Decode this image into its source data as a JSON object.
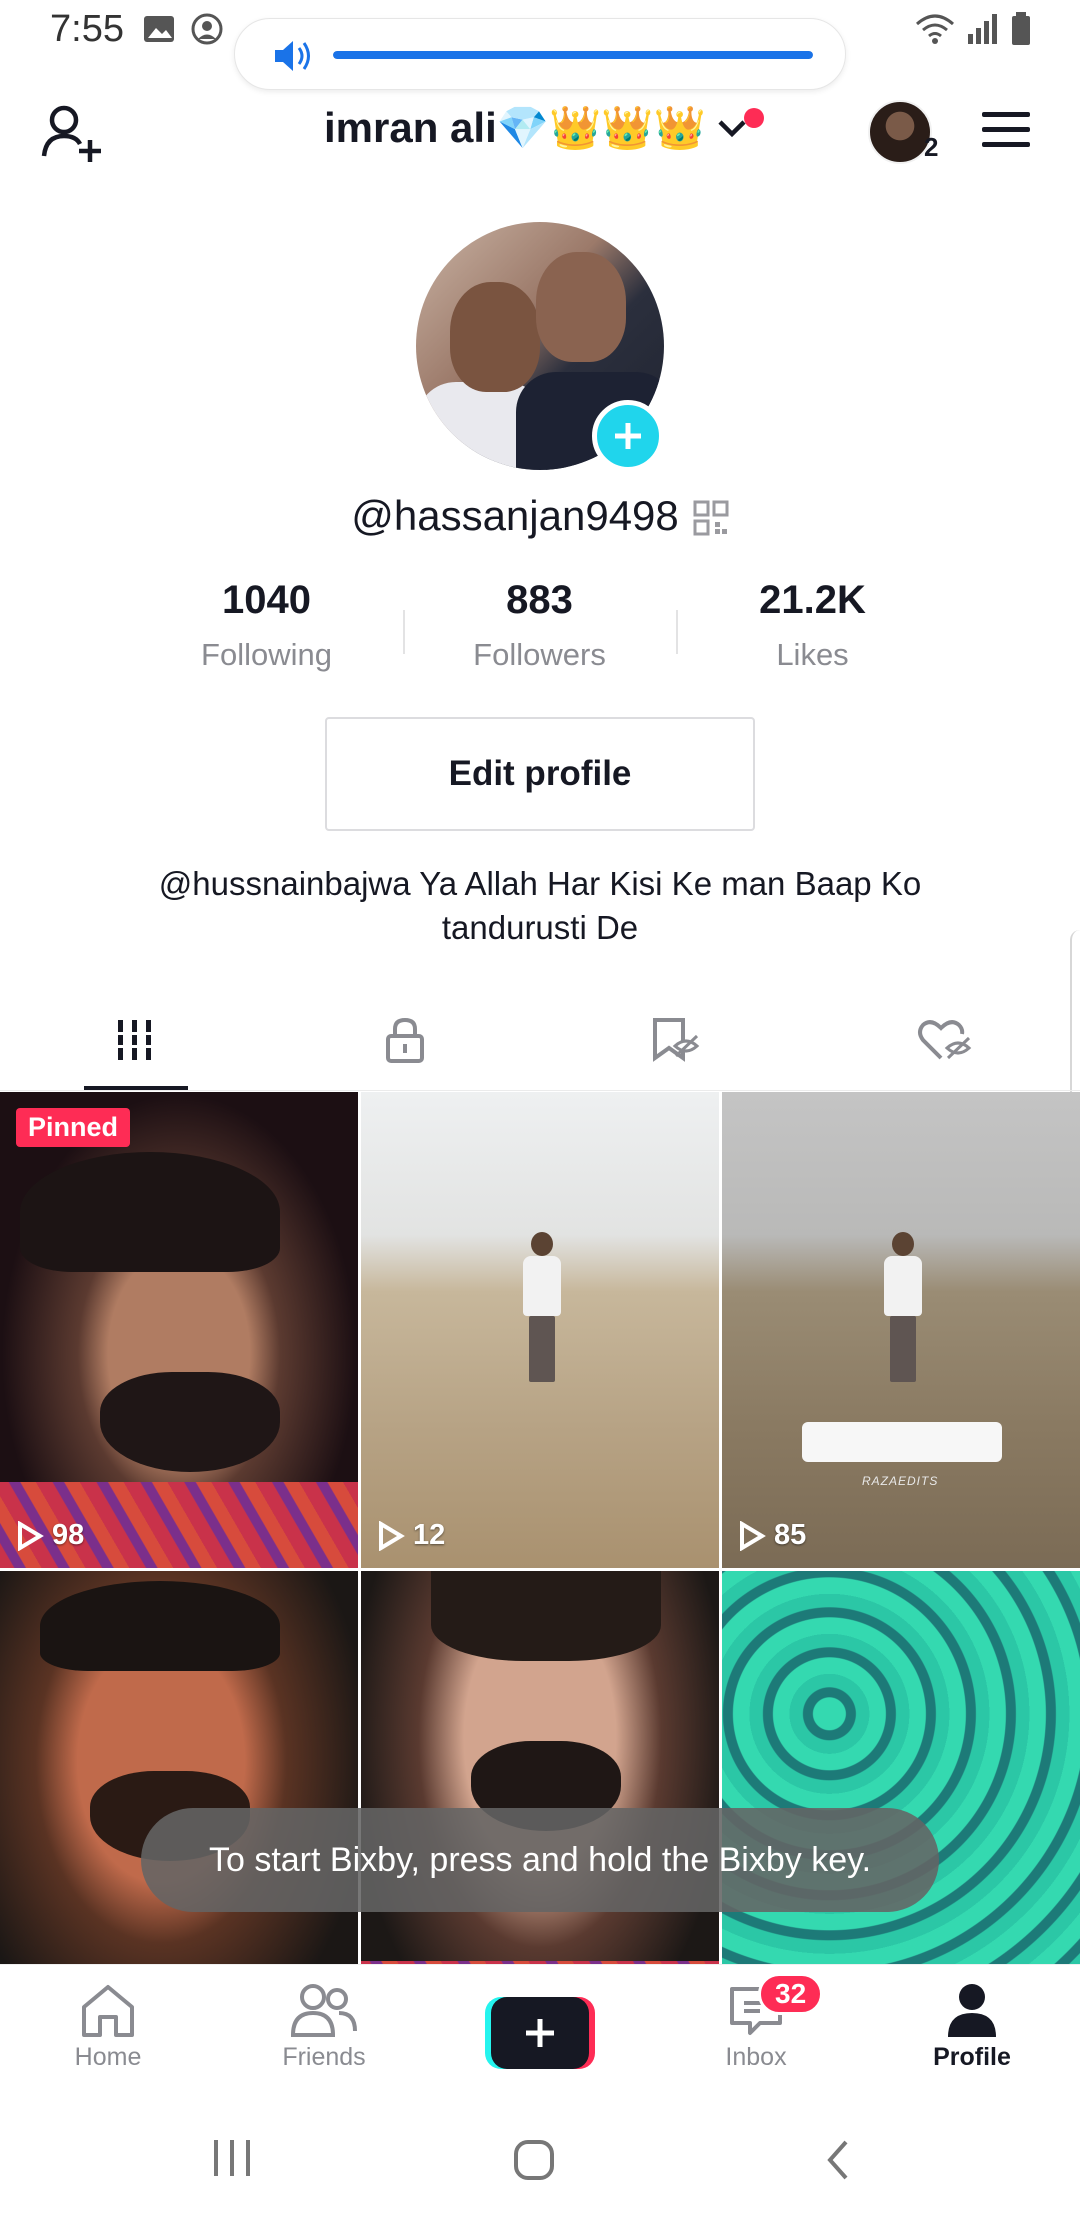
{
  "status_bar": {
    "time": "7:55"
  },
  "volume": {
    "level_percent": 100,
    "color": "#1a73e8"
  },
  "header": {
    "username": "imran ali💎👑👑👑",
    "following_avatar_count": "2"
  },
  "profile": {
    "handle": "@hassanjan9498",
    "stats": [
      {
        "value": "1040",
        "label": "Following"
      },
      {
        "value": "883",
        "label": "Followers"
      },
      {
        "value": "21.2K",
        "label": "Likes"
      }
    ],
    "edit_profile_label": "Edit profile",
    "bio_line1": "@hussnainbajwa Ya Allah Har Kisi Ke man Baap Ko",
    "bio_line2": "tandurusti De"
  },
  "tabs": [
    {
      "icon": "grid-icon",
      "active": true
    },
    {
      "icon": "lock-icon",
      "active": false
    },
    {
      "icon": "favorites-hidden-icon",
      "active": false
    },
    {
      "icon": "liked-hidden-icon",
      "active": false
    }
  ],
  "videos": [
    {
      "views": "98",
      "pinned_label": "Pinned"
    },
    {
      "views": "12"
    },
    {
      "views": "85",
      "watermark": "RAZAEDITS"
    },
    {
      "views": ""
    },
    {
      "views": ""
    },
    {
      "views": ""
    }
  ],
  "toast": "To start Bixby, press and hold the Bixby key.",
  "bottom_nav": {
    "home": "Home",
    "friends": "Friends",
    "inbox": "Inbox",
    "inbox_badge": "32",
    "profile": "Profile"
  },
  "colors": {
    "accent": "#fe2c55",
    "cyan": "#20d5ec",
    "text": "#161823",
    "muted": "#8a8b91"
  }
}
